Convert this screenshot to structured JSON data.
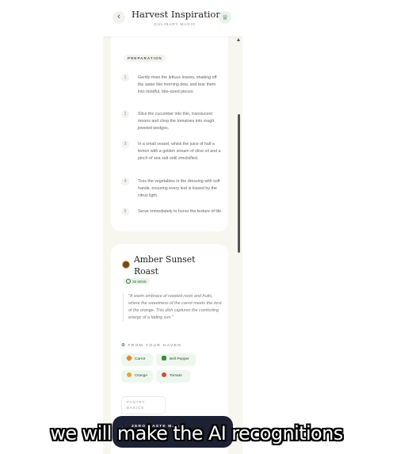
{
  "header": {
    "back_icon": "chevron-left-icon",
    "back_glyph": "‹",
    "title": "Harvest Inspirations",
    "subtitle": "CULINARY MAGIC",
    "chef_icon": "chef-hat-icon",
    "chef_glyph": "♕"
  },
  "preparation": {
    "label": "PREPARATION",
    "steps": [
      {
        "num": "1",
        "text": "Gently rinse the lettuce leaves, shaking off the water like morning dew, and tear them into mindful, bite-sized pieces."
      },
      {
        "num": "2",
        "text": "Slice the cucumber into thin, translucent moons and chop the tomatoes into rough, jeweled wedges."
      },
      {
        "num": "3",
        "text": "In a small vessel, whisk the juice of half a lemon with a golden stream of olive oil and a pinch of sea salt until emulsified."
      },
      {
        "num": "4",
        "text": "Toss the vegetables in the dressing with soft hands, ensuring every leaf is kissed by the citrus light."
      },
      {
        "num": "5",
        "text": "Serve immediately to honor the texture of life."
      }
    ]
  },
  "recipe": {
    "title": "Amber Sunset Roast",
    "icon": "roast-dish-icon",
    "time": "35 MINS",
    "description": "\"A warm embrace of roasted roots and fruits, where the sweetness of the carrot meets the zest of the orange. This dish captures the comforting energy of a fading sun.\"",
    "haven_label": "FROM YOUR HAVEN",
    "ingredients": [
      {
        "label": "Carrot",
        "icon": "carrot-icon",
        "color": "#e8892b"
      },
      {
        "label": "Bell Pepper",
        "icon": "bell-pepper-icon",
        "color": "#3f8a3c"
      },
      {
        "label": "Orange",
        "icon": "orange-icon",
        "color": "#f0a030"
      },
      {
        "label": "Tomato",
        "icon": "tomato-icon",
        "color": "#d9482f"
      }
    ],
    "pantry_label": "PANTRY BASICS"
  },
  "banner": {
    "text": "ZERO WASTE MAGIC UNLOCKED",
    "icon": "sparkle-icon"
  },
  "caption": "we will make the AI recognitions",
  "colors": {
    "accent_green": "#2e6b3a",
    "banner_dark": "#1c2233",
    "background": "#f7f6ef"
  }
}
